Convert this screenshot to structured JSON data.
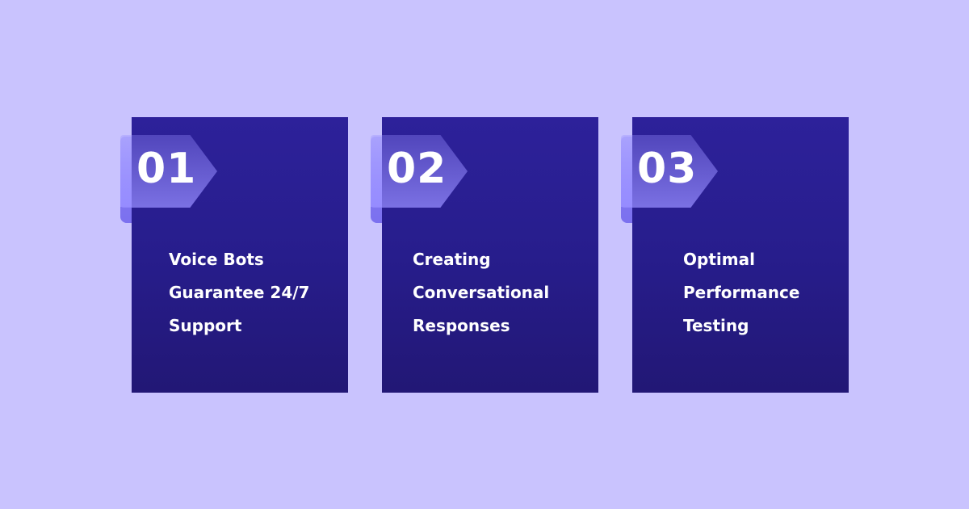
{
  "colors": {
    "background": "#c9c3fe",
    "card_top": "#2d219a",
    "card_bottom": "#221775",
    "badge": "#968cff",
    "text": "#ffffff"
  },
  "cards": [
    {
      "number": "01",
      "lines": [
        "Voice Bots",
        "Guarantee 24/7",
        "Support"
      ]
    },
    {
      "number": "02",
      "lines": [
        "Creating",
        "Conversational",
        "Responses"
      ]
    },
    {
      "number": "03",
      "lines": [
        "Optimal",
        "Performance",
        "Testing"
      ]
    }
  ]
}
